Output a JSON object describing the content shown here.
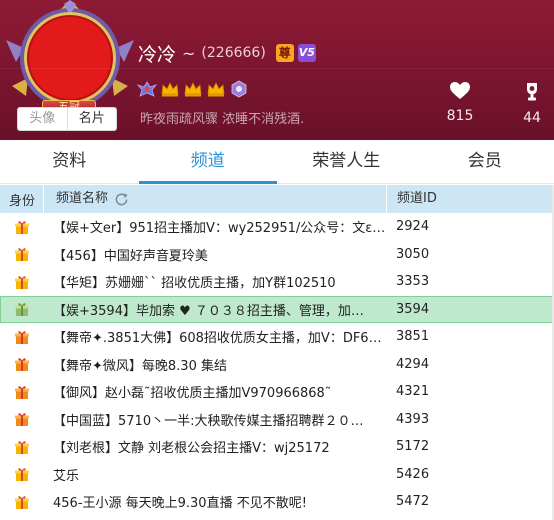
{
  "profile": {
    "nickname": "冷冷",
    "tilde": "~",
    "uid": "(226666)",
    "badge_zun": "尊",
    "badge_vip": "V5",
    "level_badge": "五冠",
    "signature": "昨夜雨疏风骤 浓睡不消残酒.",
    "avatar_tabs": [
      "头像",
      "名片"
    ],
    "stats": {
      "likes": "815",
      "trophies": "44"
    }
  },
  "tabs": [
    "资料",
    "频道",
    "荣誉人生",
    "会员"
  ],
  "active_tab": 1,
  "table": {
    "headers": {
      "role": "身份",
      "name": "频道名称",
      "id": "频道ID"
    },
    "rows": [
      {
        "name": "【娱+文er】951招主播加V：wy252951/公众号：文ε…",
        "id": "2924",
        "gift": "yellow"
      },
      {
        "name": "【456】中国好声音夏玲美",
        "id": "3050",
        "gift": "yellow"
      },
      {
        "name": "【华矩】苏姗姗`` 招收优质主播，加Y群102510",
        "id": "3353",
        "gift": "yellow"
      },
      {
        "name": "【娱+3594】毕加索 ♥ ７０３８招主播、管理，加…",
        "id": "3594",
        "gift": "green"
      },
      {
        "name": "【舞帝✦.3851大佛】608招收优质女主播，加V：DF6…",
        "id": "3851",
        "gift": "orange"
      },
      {
        "name": "【舞帝✦微风】每晚8.30 集结",
        "id": "4294",
        "gift": "orange"
      },
      {
        "name": "【御风】赵小磊˜招收优质主播加V970966868˜",
        "id": "4321",
        "gift": "orange"
      },
      {
        "name": "【中国蓝】5710丶一半:大秧歌传媒主播招聘群２０…",
        "id": "4393",
        "gift": "orange"
      },
      {
        "name": "【刘老根】文静 刘老根公会招主播V：wj25172",
        "id": "5172",
        "gift": "yellow"
      },
      {
        "name": "艾乐",
        "id": "5426",
        "gift": "yellow"
      },
      {
        "name": "456-王小源 每天晚上9.30直播 不见不散呢!",
        "id": "5472",
        "gift": "yellow"
      }
    ]
  },
  "colors": {
    "header_bg": "#7b1530",
    "accent_blue": "#2a93d5",
    "table_header_bg": "#cde6f6",
    "selected_row_bg": "#bfe9cc"
  },
  "icons": {
    "refresh": "refresh-icon",
    "heart": "heart-icon",
    "trophy": "trophy-icon",
    "gift": "gift-icon",
    "crown": "crown-icon"
  }
}
